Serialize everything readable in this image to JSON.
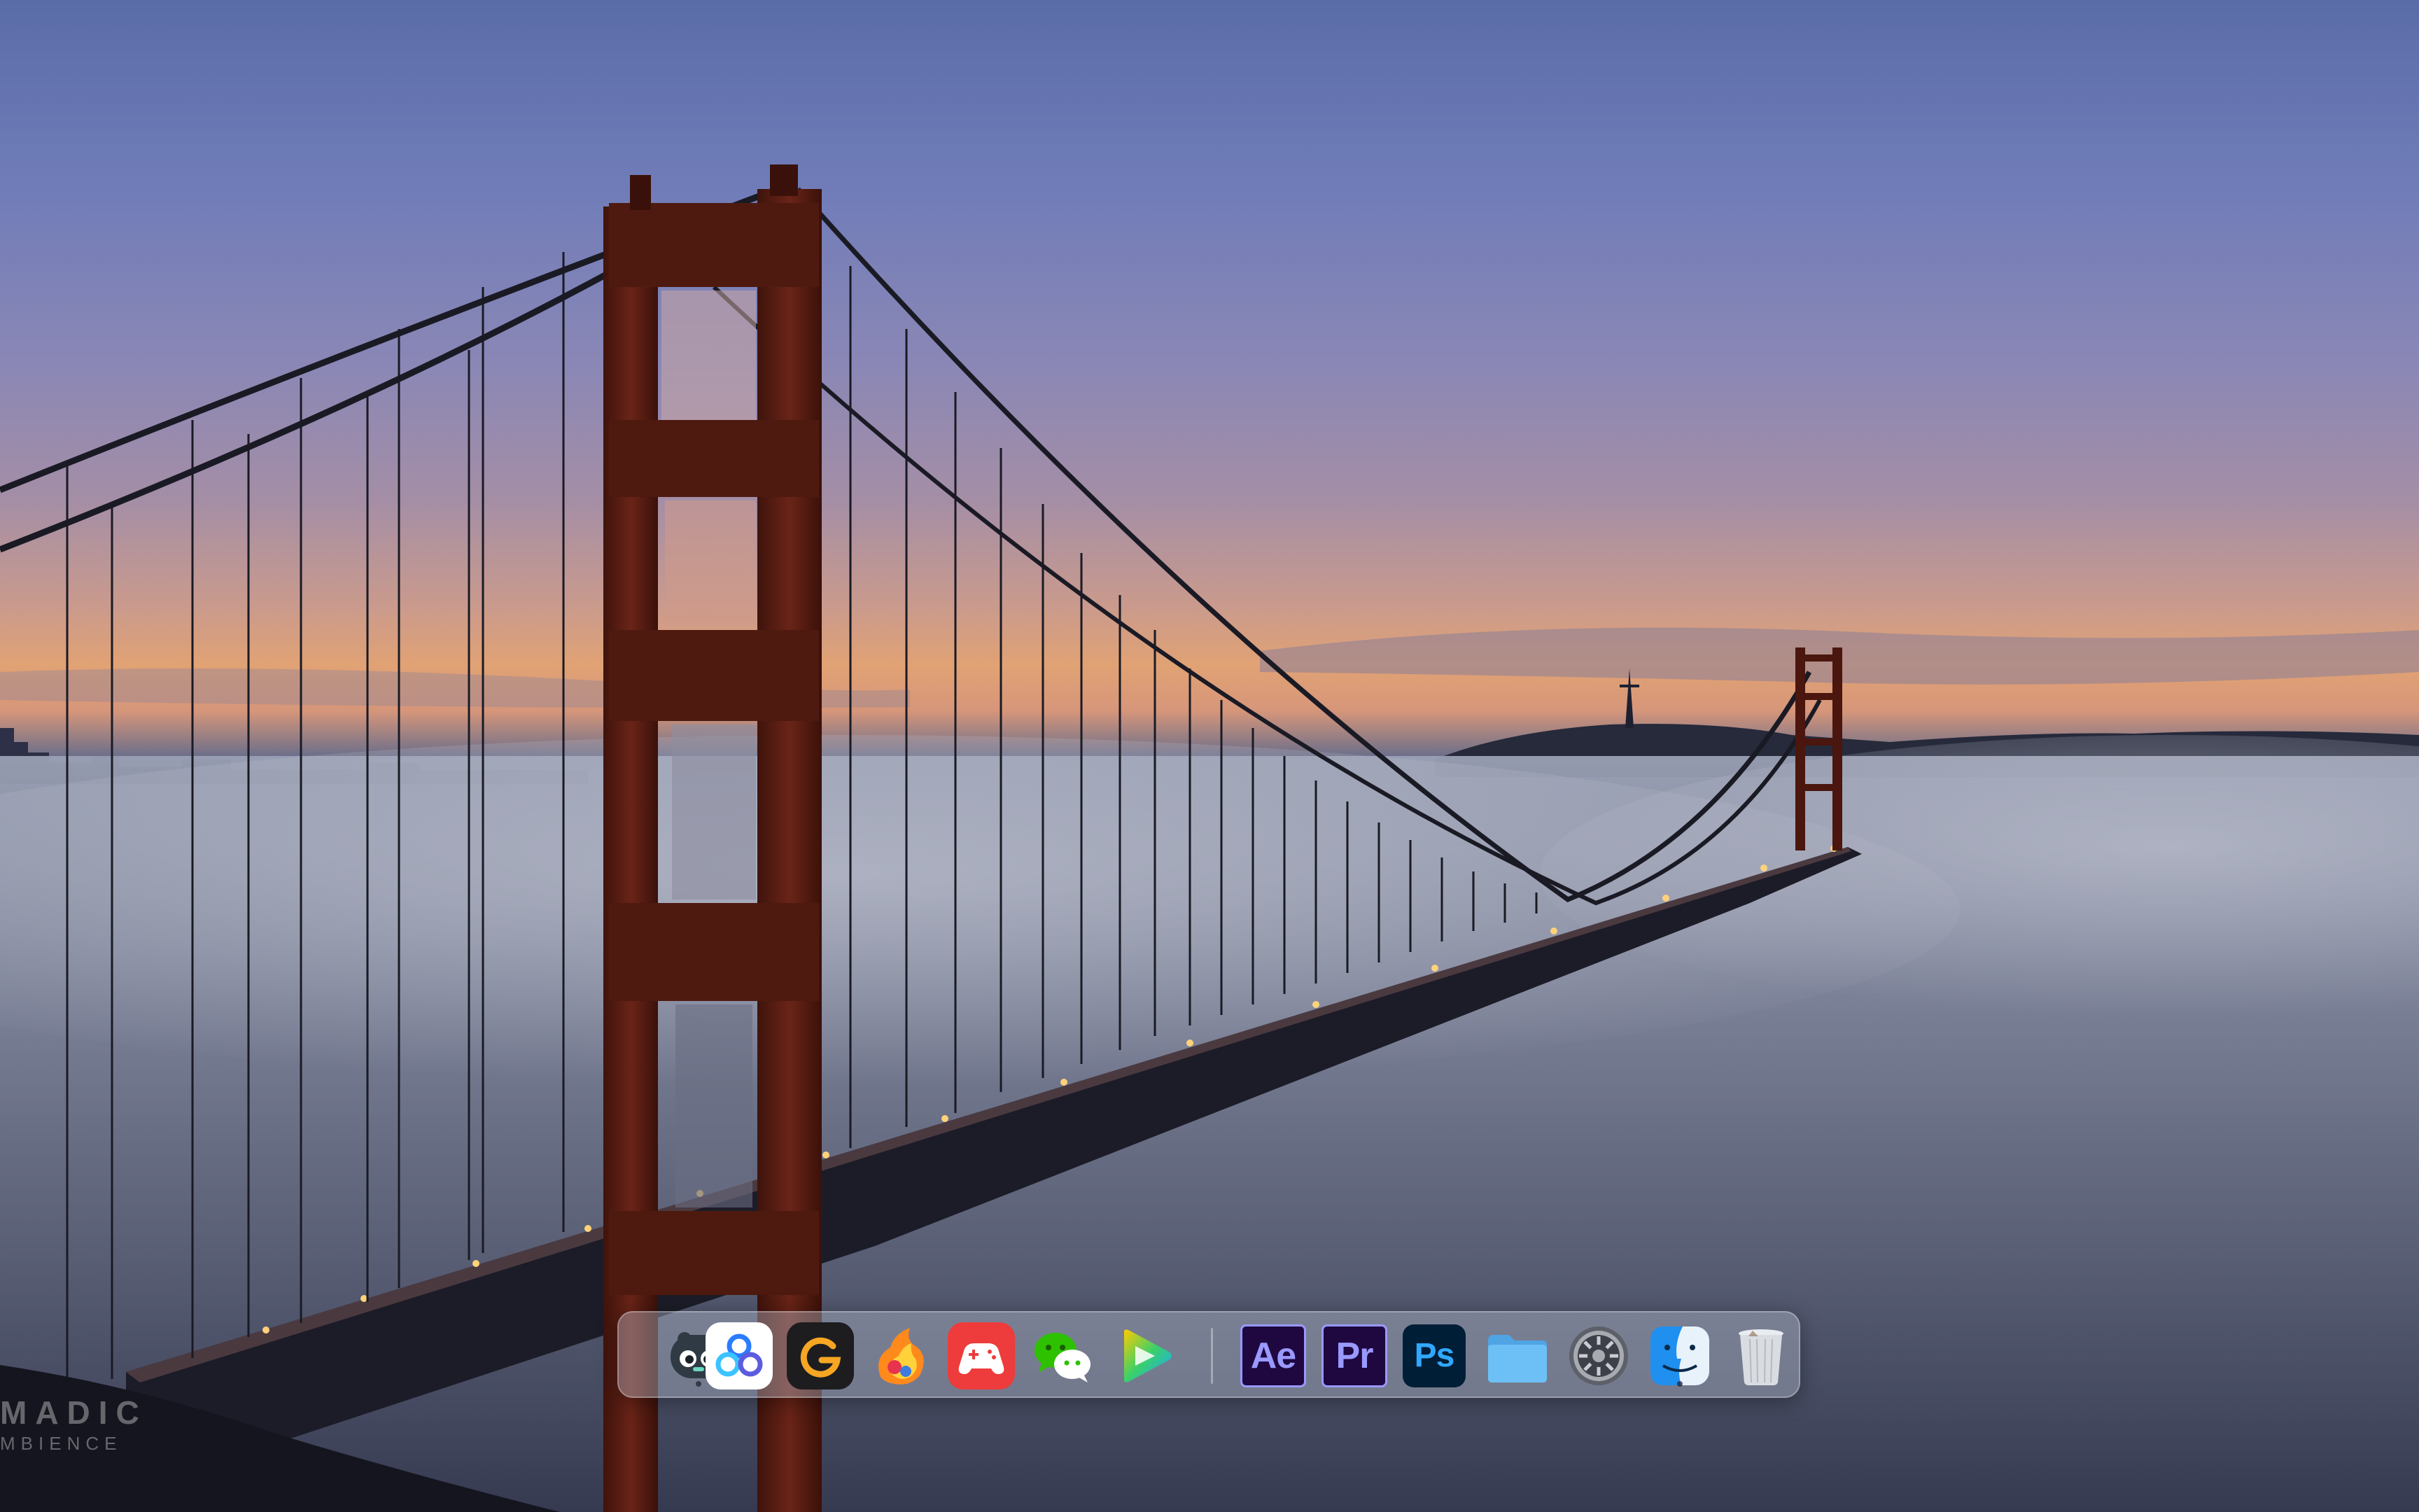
{
  "watermark": {
    "line1": "MADIC",
    "line2": "MBIENCE"
  },
  "dock": {
    "apps": [
      {
        "name": "Game Controller",
        "icon": "gamepad-bear-icon",
        "running": true
      },
      {
        "name": "Baidu Netdisk",
        "icon": "cloud-sync-icon",
        "running": false
      },
      {
        "name": "App",
        "icon": "g-letter-icon",
        "running": false
      },
      {
        "name": "Game",
        "icon": "flame-bird-icon",
        "running": false
      },
      {
        "name": "Games",
        "icon": "red-gamepad-icon",
        "running": false
      },
      {
        "name": "WeChat",
        "icon": "chat-bubbles-icon",
        "running": false
      },
      {
        "name": "Video Player",
        "icon": "play-triangle-icon",
        "running": false
      }
    ],
    "adobe": [
      {
        "name": "After Effects",
        "label": "Ae",
        "bg": "#1f0740",
        "fg": "#9999ff",
        "icon": "after-effects-icon"
      },
      {
        "name": "Premiere Pro",
        "label": "Pr",
        "bg": "#1f0740",
        "fg": "#9999ff",
        "icon": "premiere-pro-icon"
      },
      {
        "name": "Photoshop",
        "label": "Ps",
        "bg": "#001e36",
        "fg": "#31a8ff",
        "icon": "photoshop-icon"
      }
    ],
    "right_apps": [
      {
        "name": "Folder",
        "icon": "folder-icon",
        "running": false
      },
      {
        "name": "System Preferences",
        "icon": "gear-icon",
        "running": false
      },
      {
        "name": "Finder",
        "icon": "finder-face-icon",
        "running": true
      },
      {
        "name": "Trash",
        "icon": "trash-icon",
        "running": false
      }
    ]
  },
  "colors": {
    "bridge": "#5a1e14",
    "bridge_dark": "#3a120c",
    "ae_fg": "#9999ff",
    "ps_fg": "#31a8ff"
  }
}
